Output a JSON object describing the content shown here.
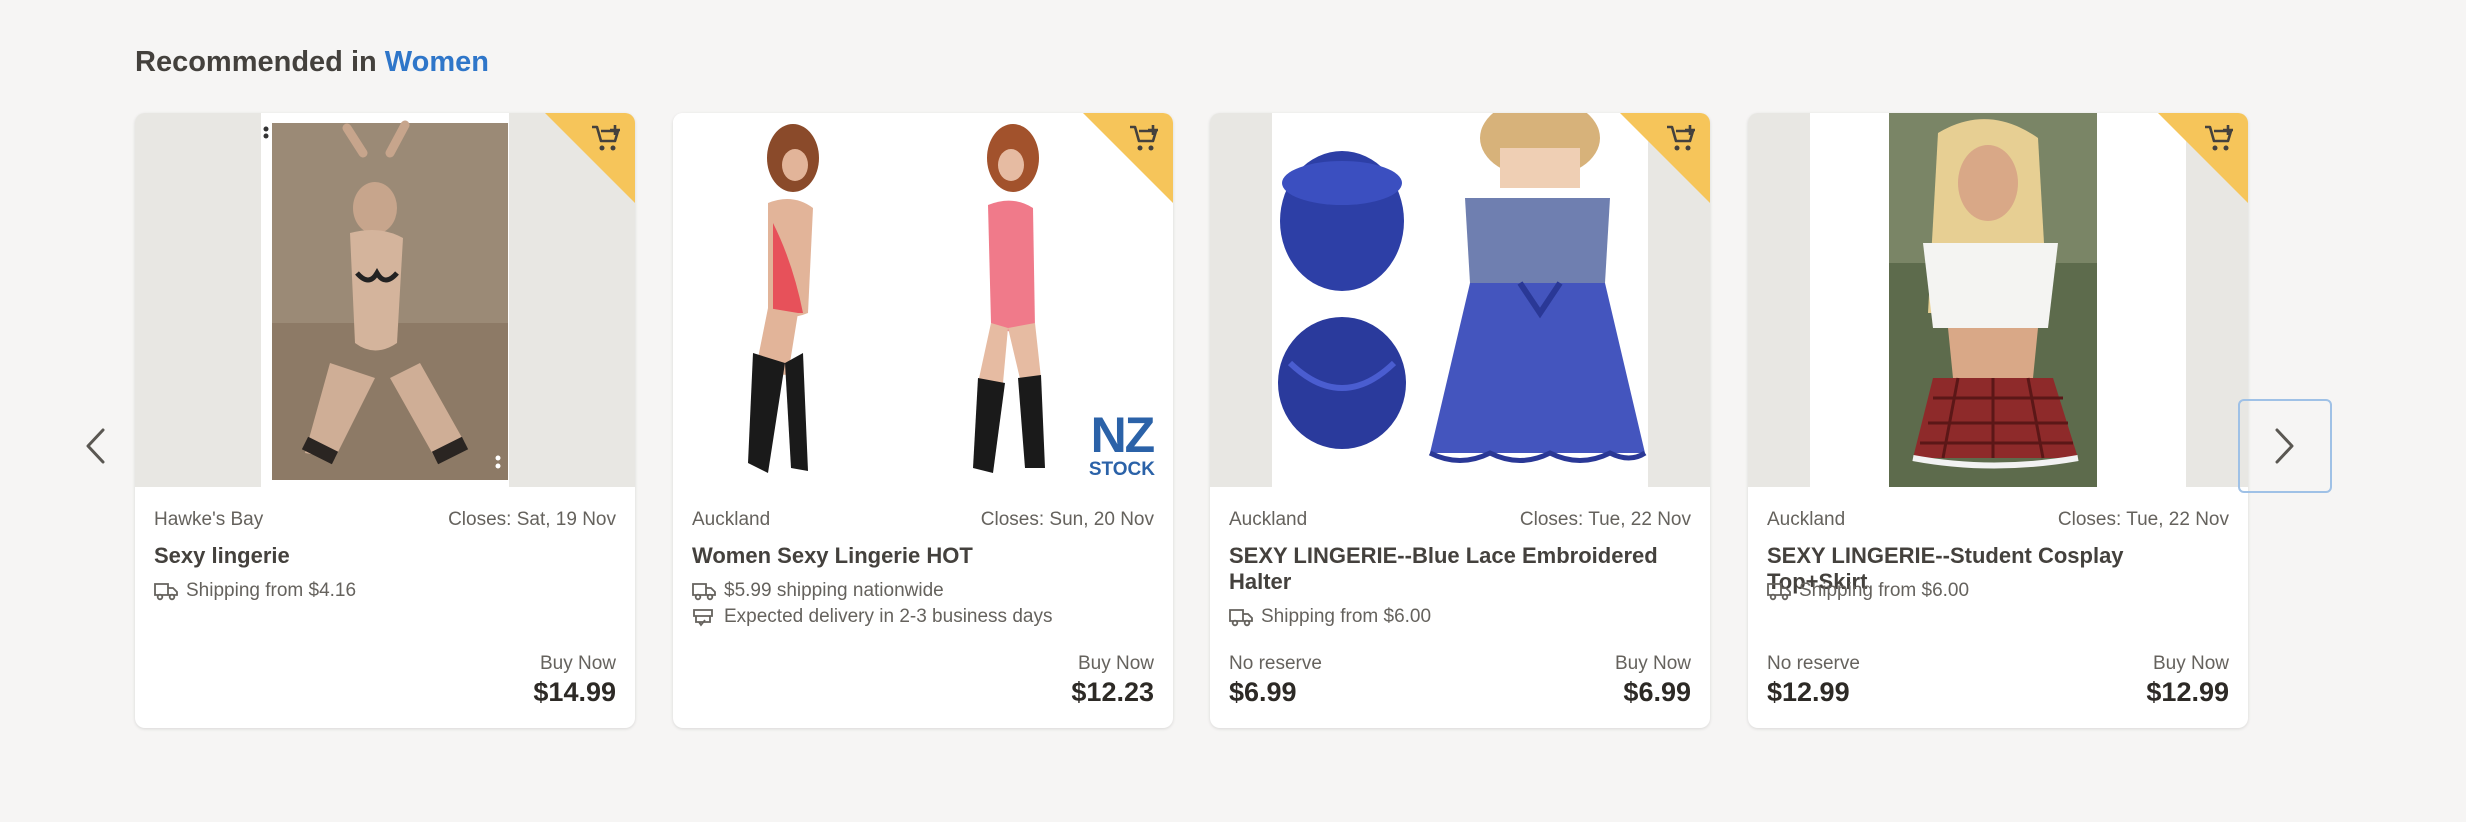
{
  "section": {
    "prefix": "Recommended in ",
    "category": "Women"
  },
  "colors": {
    "accent": "#2f76c9",
    "watch_corner": "#f6c55a",
    "background": "#f6f5f4"
  },
  "icons": {
    "watchlist": "watchlist-add-icon",
    "shipping": "truck-icon",
    "delivery": "delivery-cart-icon",
    "prev": "chevron-left-icon",
    "next": "chevron-right-icon"
  },
  "listings": [
    {
      "location": "Hawke's Bay",
      "closes": "Closes: Sat, 19 Nov",
      "title": "Sexy lingerie",
      "shipping": "Shipping from $4.16",
      "buy_now_label": "Buy Now",
      "buy_now_price": "$14.99"
    },
    {
      "location": "Auckland",
      "closes": "Closes: Sun, 20 Nov",
      "title": "Women Sexy Lingerie HOT",
      "shipping": "$5.99 shipping nationwide",
      "delivery": "Expected delivery in 2-3 business days",
      "buy_now_label": "Buy Now",
      "buy_now_price": "$12.23",
      "badge": {
        "top": "NZ",
        "bottom": "STOCK"
      }
    },
    {
      "location": "Auckland",
      "closes": "Closes: Tue, 22 Nov",
      "title": "SEXY LINGERIE--Blue Lace Embroidered Halter",
      "shipping": "Shipping from $6.00",
      "reserve_label": "No reserve",
      "reserve_price": "$6.99",
      "buy_now_label": "Buy Now",
      "buy_now_price": "$6.99"
    },
    {
      "location": "Auckland",
      "closes": "Closes: Tue, 22 Nov",
      "title": "SEXY LINGERIE--Student Cosplay Top+Skirt",
      "shipping": "Shipping from $6.00",
      "reserve_label": "No reserve",
      "reserve_price": "$12.99",
      "buy_now_label": "Buy Now",
      "buy_now_price": "$12.99"
    }
  ]
}
